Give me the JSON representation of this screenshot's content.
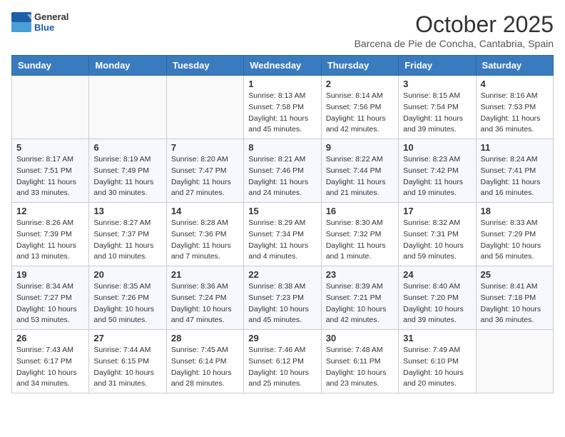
{
  "header": {
    "logo_line1": "General",
    "logo_line2": "Blue",
    "month": "October 2025",
    "location": "Barcena de Pie de Concha, Cantabria, Spain"
  },
  "weekdays": [
    "Sunday",
    "Monday",
    "Tuesday",
    "Wednesday",
    "Thursday",
    "Friday",
    "Saturday"
  ],
  "weeks": [
    [
      {
        "day": "",
        "sunrise": "",
        "sunset": "",
        "daylight": ""
      },
      {
        "day": "",
        "sunrise": "",
        "sunset": "",
        "daylight": ""
      },
      {
        "day": "",
        "sunrise": "",
        "sunset": "",
        "daylight": ""
      },
      {
        "day": "1",
        "sunrise": "Sunrise: 8:13 AM",
        "sunset": "Sunset: 7:58 PM",
        "daylight": "Daylight: 11 hours and 45 minutes."
      },
      {
        "day": "2",
        "sunrise": "Sunrise: 8:14 AM",
        "sunset": "Sunset: 7:56 PM",
        "daylight": "Daylight: 11 hours and 42 minutes."
      },
      {
        "day": "3",
        "sunrise": "Sunrise: 8:15 AM",
        "sunset": "Sunset: 7:54 PM",
        "daylight": "Daylight: 11 hours and 39 minutes."
      },
      {
        "day": "4",
        "sunrise": "Sunrise: 8:16 AM",
        "sunset": "Sunset: 7:53 PM",
        "daylight": "Daylight: 11 hours and 36 minutes."
      }
    ],
    [
      {
        "day": "5",
        "sunrise": "Sunrise: 8:17 AM",
        "sunset": "Sunset: 7:51 PM",
        "daylight": "Daylight: 11 hours and 33 minutes."
      },
      {
        "day": "6",
        "sunrise": "Sunrise: 8:19 AM",
        "sunset": "Sunset: 7:49 PM",
        "daylight": "Daylight: 11 hours and 30 minutes."
      },
      {
        "day": "7",
        "sunrise": "Sunrise: 8:20 AM",
        "sunset": "Sunset: 7:47 PM",
        "daylight": "Daylight: 11 hours and 27 minutes."
      },
      {
        "day": "8",
        "sunrise": "Sunrise: 8:21 AM",
        "sunset": "Sunset: 7:46 PM",
        "daylight": "Daylight: 11 hours and 24 minutes."
      },
      {
        "day": "9",
        "sunrise": "Sunrise: 8:22 AM",
        "sunset": "Sunset: 7:44 PM",
        "daylight": "Daylight: 11 hours and 21 minutes."
      },
      {
        "day": "10",
        "sunrise": "Sunrise: 8:23 AM",
        "sunset": "Sunset: 7:42 PM",
        "daylight": "Daylight: 11 hours and 19 minutes."
      },
      {
        "day": "11",
        "sunrise": "Sunrise: 8:24 AM",
        "sunset": "Sunset: 7:41 PM",
        "daylight": "Daylight: 11 hours and 16 minutes."
      }
    ],
    [
      {
        "day": "12",
        "sunrise": "Sunrise: 8:26 AM",
        "sunset": "Sunset: 7:39 PM",
        "daylight": "Daylight: 11 hours and 13 minutes."
      },
      {
        "day": "13",
        "sunrise": "Sunrise: 8:27 AM",
        "sunset": "Sunset: 7:37 PM",
        "daylight": "Daylight: 11 hours and 10 minutes."
      },
      {
        "day": "14",
        "sunrise": "Sunrise: 8:28 AM",
        "sunset": "Sunset: 7:36 PM",
        "daylight": "Daylight: 11 hours and 7 minutes."
      },
      {
        "day": "15",
        "sunrise": "Sunrise: 8:29 AM",
        "sunset": "Sunset: 7:34 PM",
        "daylight": "Daylight: 11 hours and 4 minutes."
      },
      {
        "day": "16",
        "sunrise": "Sunrise: 8:30 AM",
        "sunset": "Sunset: 7:32 PM",
        "daylight": "Daylight: 11 hours and 1 minute."
      },
      {
        "day": "17",
        "sunrise": "Sunrise: 8:32 AM",
        "sunset": "Sunset: 7:31 PM",
        "daylight": "Daylight: 10 hours and 59 minutes."
      },
      {
        "day": "18",
        "sunrise": "Sunrise: 8:33 AM",
        "sunset": "Sunset: 7:29 PM",
        "daylight": "Daylight: 10 hours and 56 minutes."
      }
    ],
    [
      {
        "day": "19",
        "sunrise": "Sunrise: 8:34 AM",
        "sunset": "Sunset: 7:27 PM",
        "daylight": "Daylight: 10 hours and 53 minutes."
      },
      {
        "day": "20",
        "sunrise": "Sunrise: 8:35 AM",
        "sunset": "Sunset: 7:26 PM",
        "daylight": "Daylight: 10 hours and 50 minutes."
      },
      {
        "day": "21",
        "sunrise": "Sunrise: 8:36 AM",
        "sunset": "Sunset: 7:24 PM",
        "daylight": "Daylight: 10 hours and 47 minutes."
      },
      {
        "day": "22",
        "sunrise": "Sunrise: 8:38 AM",
        "sunset": "Sunset: 7:23 PM",
        "daylight": "Daylight: 10 hours and 45 minutes."
      },
      {
        "day": "23",
        "sunrise": "Sunrise: 8:39 AM",
        "sunset": "Sunset: 7:21 PM",
        "daylight": "Daylight: 10 hours and 42 minutes."
      },
      {
        "day": "24",
        "sunrise": "Sunrise: 8:40 AM",
        "sunset": "Sunset: 7:20 PM",
        "daylight": "Daylight: 10 hours and 39 minutes."
      },
      {
        "day": "25",
        "sunrise": "Sunrise: 8:41 AM",
        "sunset": "Sunset: 7:18 PM",
        "daylight": "Daylight: 10 hours and 36 minutes."
      }
    ],
    [
      {
        "day": "26",
        "sunrise": "Sunrise: 7:43 AM",
        "sunset": "Sunset: 6:17 PM",
        "daylight": "Daylight: 10 hours and 34 minutes."
      },
      {
        "day": "27",
        "sunrise": "Sunrise: 7:44 AM",
        "sunset": "Sunset: 6:15 PM",
        "daylight": "Daylight: 10 hours and 31 minutes."
      },
      {
        "day": "28",
        "sunrise": "Sunrise: 7:45 AM",
        "sunset": "Sunset: 6:14 PM",
        "daylight": "Daylight: 10 hours and 28 minutes."
      },
      {
        "day": "29",
        "sunrise": "Sunrise: 7:46 AM",
        "sunset": "Sunset: 6:12 PM",
        "daylight": "Daylight: 10 hours and 25 minutes."
      },
      {
        "day": "30",
        "sunrise": "Sunrise: 7:48 AM",
        "sunset": "Sunset: 6:11 PM",
        "daylight": "Daylight: 10 hours and 23 minutes."
      },
      {
        "day": "31",
        "sunrise": "Sunrise: 7:49 AM",
        "sunset": "Sunset: 6:10 PM",
        "daylight": "Daylight: 10 hours and 20 minutes."
      },
      {
        "day": "",
        "sunrise": "",
        "sunset": "",
        "daylight": ""
      }
    ]
  ]
}
